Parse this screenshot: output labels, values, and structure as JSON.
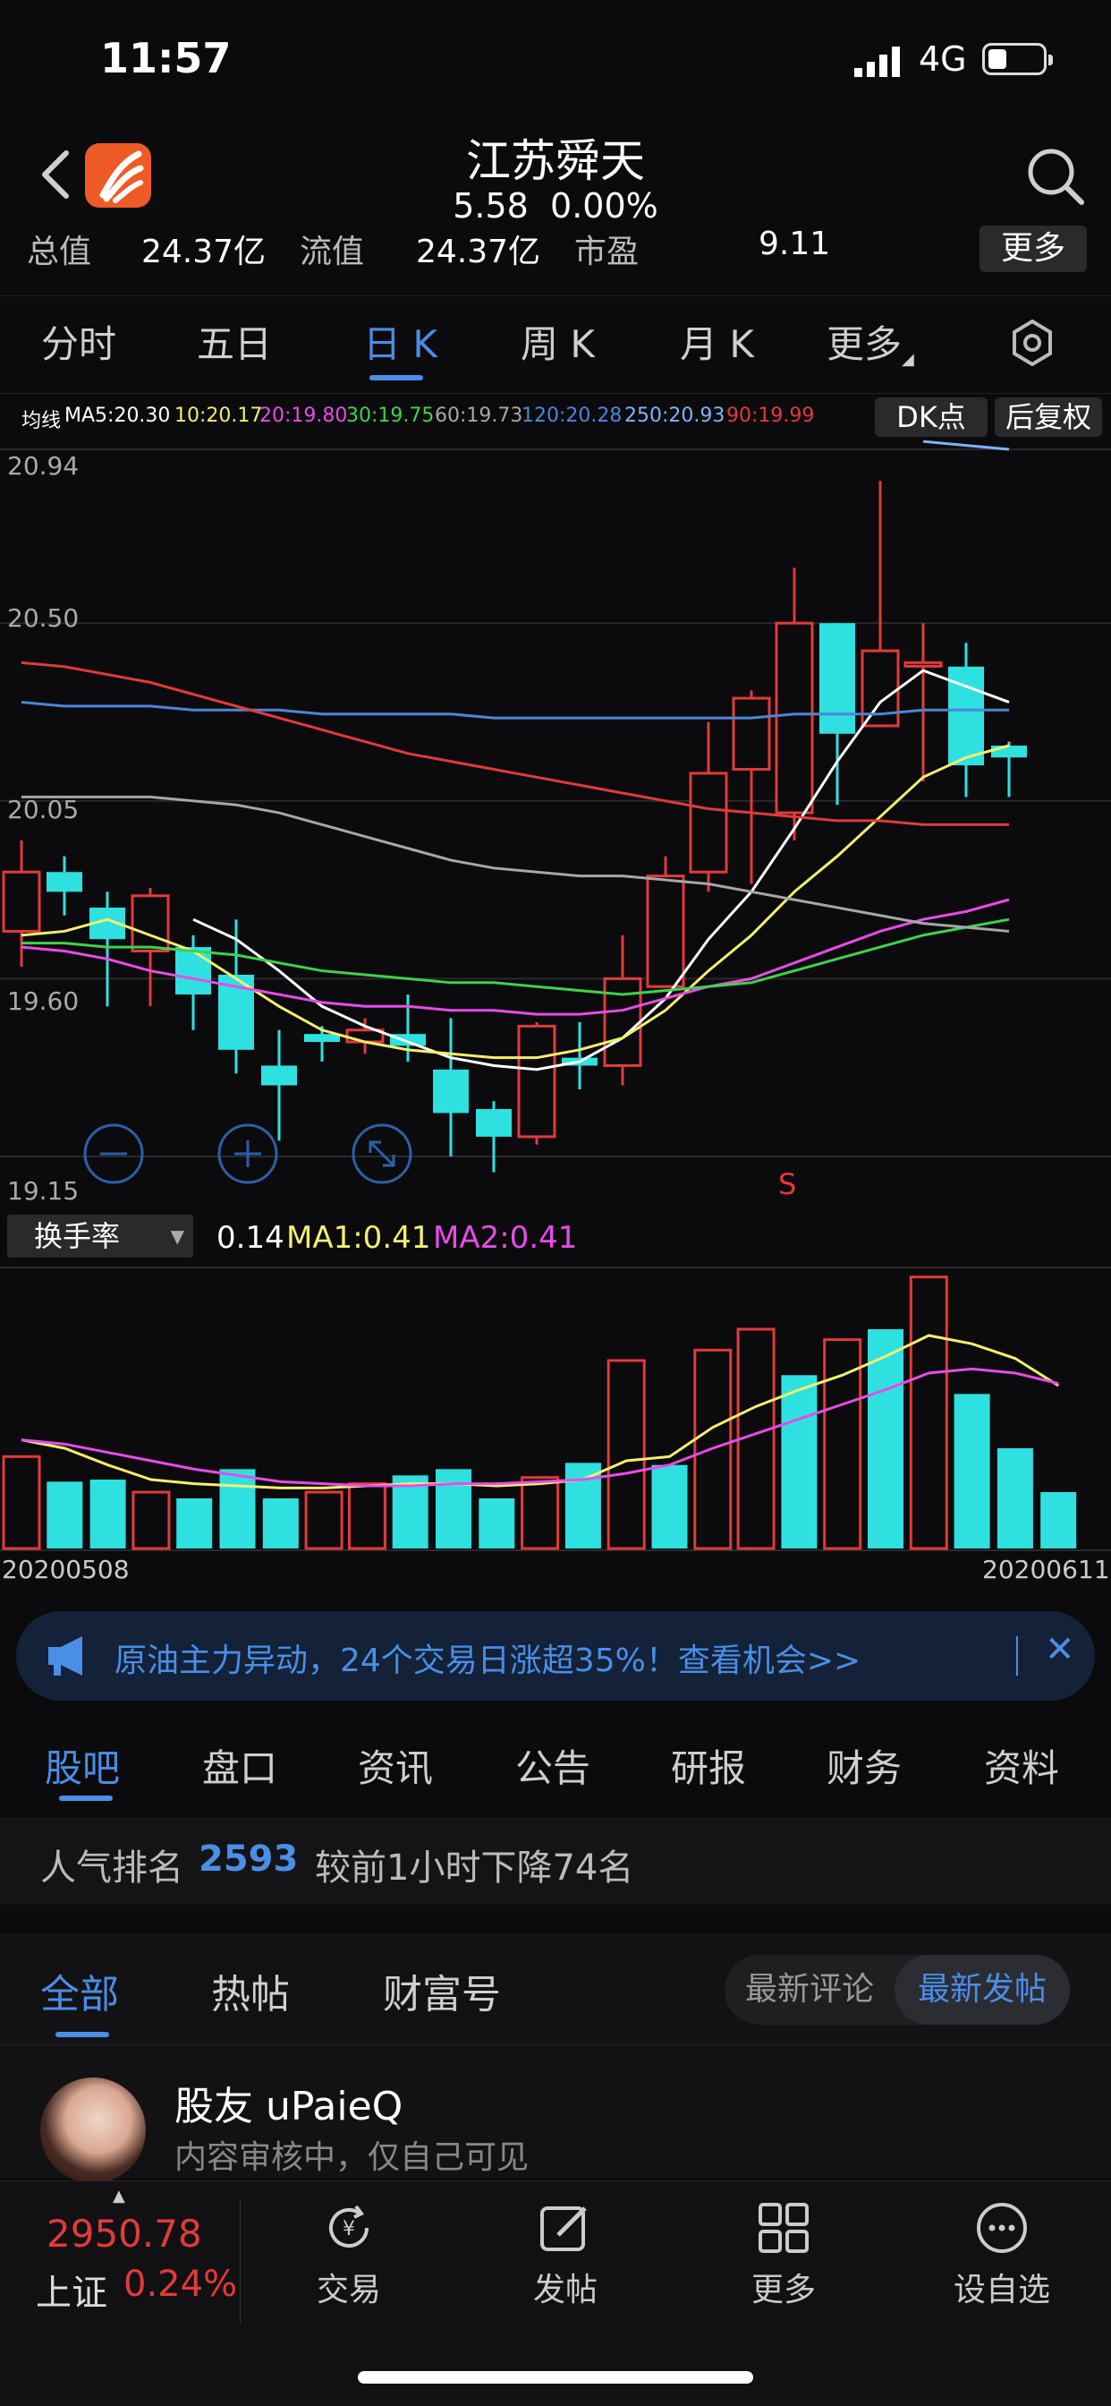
{
  "status_bar": {
    "time": "11:57",
    "network": "4G"
  },
  "header": {
    "title": "江苏舜天",
    "price": "5.58",
    "change_pct": "0.00%"
  },
  "metrics": {
    "total_label": "总值",
    "total_value": "24.37亿",
    "float_label": "流值",
    "float_value": "24.37亿",
    "pe_label": "市盈",
    "pe_value": "9.11",
    "more_label": "更多"
  },
  "period_tabs": [
    "分时",
    "五日",
    "日 K",
    "周 K",
    "月 K",
    "更多"
  ],
  "active_period": "日 K",
  "ma_legend": {
    "prefix": "均线",
    "items": [
      {
        "text": "MA5:20.30",
        "color": "#ffffff"
      },
      {
        "text": "10:20.17",
        "color": "#f4ef6e"
      },
      {
        "text": "20:19.80",
        "color": "#e84be8"
      },
      {
        "text": "30:19.75",
        "color": "#3fd24a"
      },
      {
        "text": "60:19.73",
        "color": "#a7a7a7"
      },
      {
        "text": "120:20.28",
        "color": "#4b86d8"
      },
      {
        "text": "250:20.93",
        "color": "#7fb3ff"
      },
      {
        "text": "90:19.99",
        "color": "#e23a3a"
      }
    ],
    "dk_label": "DK点",
    "adjust_label": "后复权"
  },
  "kline": {
    "y_labels": [
      "20.94",
      "20.50",
      "20.05",
      "19.60",
      "19.15"
    ],
    "signal_label": "S",
    "candles": [
      {
        "o": 19.72,
        "c": 19.87,
        "h": 19.95,
        "l": 19.63
      },
      {
        "o": 19.87,
        "c": 19.82,
        "h": 19.91,
        "l": 19.76
      },
      {
        "o": 19.78,
        "c": 19.7,
        "h": 19.82,
        "l": 19.53
      },
      {
        "o": 19.67,
        "c": 19.81,
        "h": 19.83,
        "l": 19.53
      },
      {
        "o": 19.68,
        "c": 19.56,
        "h": 19.71,
        "l": 19.47
      },
      {
        "o": 19.61,
        "c": 19.42,
        "h": 19.75,
        "l": 19.36
      },
      {
        "o": 19.38,
        "c": 19.33,
        "h": 19.47,
        "l": 19.19
      },
      {
        "o": 19.46,
        "c": 19.44,
        "h": 19.48,
        "l": 19.39
      },
      {
        "o": 19.44,
        "c": 19.47,
        "h": 19.5,
        "l": 19.41
      },
      {
        "o": 19.46,
        "c": 19.43,
        "h": 19.56,
        "l": 19.39
      },
      {
        "o": 19.37,
        "c": 19.26,
        "h": 19.5,
        "l": 19.15
      },
      {
        "o": 19.27,
        "c": 19.2,
        "h": 19.29,
        "l": 19.11
      },
      {
        "o": 19.2,
        "c": 19.48,
        "h": 19.49,
        "l": 19.18
      },
      {
        "o": 19.4,
        "c": 19.38,
        "h": 19.49,
        "l": 19.32
      },
      {
        "o": 19.38,
        "c": 19.6,
        "h": 19.71,
        "l": 19.33
      },
      {
        "o": 19.58,
        "c": 19.86,
        "h": 19.91,
        "l": 19.58
      },
      {
        "o": 19.87,
        "c": 20.12,
        "h": 20.25,
        "l": 19.82
      },
      {
        "o": 20.13,
        "c": 20.31,
        "h": 20.33,
        "l": 19.84
      },
      {
        "o": 20.02,
        "c": 20.5,
        "h": 20.64,
        "l": 19.95
      },
      {
        "o": 20.5,
        "c": 20.22,
        "h": 20.5,
        "l": 20.04
      },
      {
        "o": 20.24,
        "c": 20.43,
        "h": 20.86,
        "l": 20.24
      },
      {
        "o": 20.4,
        "c": 20.4,
        "h": 20.5,
        "l": 20.1
      },
      {
        "o": 20.39,
        "c": 20.14,
        "h": 20.45,
        "l": 20.06
      },
      {
        "o": 20.19,
        "c": 20.16,
        "h": 20.2,
        "l": 20.06
      }
    ],
    "ma_lines": [
      {
        "color": "#ffffff",
        "y": [
          null,
          null,
          null,
          null,
          19.75,
          19.7,
          19.62,
          19.53,
          19.48,
          19.44,
          19.4,
          19.38,
          19.37,
          19.39,
          19.45,
          19.55,
          19.7,
          19.82,
          19.98,
          20.15,
          20.3,
          20.38,
          20.34,
          20.3
        ]
      },
      {
        "color": "#f4ef6e",
        "y": [
          19.71,
          19.72,
          19.75,
          19.71,
          19.67,
          19.6,
          19.53,
          19.47,
          19.44,
          19.42,
          19.41,
          19.4,
          19.4,
          19.42,
          19.45,
          19.52,
          19.62,
          19.71,
          19.82,
          19.91,
          20.01,
          20.11,
          20.16,
          20.19
        ]
      },
      {
        "color": "#e84be8",
        "y": [
          19.68,
          19.67,
          19.65,
          19.62,
          19.6,
          19.58,
          19.56,
          19.54,
          19.53,
          19.53,
          19.52,
          19.52,
          19.51,
          19.51,
          19.52,
          19.55,
          19.58,
          19.6,
          19.64,
          19.68,
          19.72,
          19.75,
          19.77,
          19.8
        ]
      },
      {
        "color": "#3fd24a",
        "y": [
          19.69,
          19.69,
          19.68,
          19.68,
          19.67,
          19.66,
          19.64,
          19.62,
          19.61,
          19.6,
          19.59,
          19.59,
          19.58,
          19.57,
          19.56,
          19.57,
          19.58,
          19.59,
          19.62,
          19.65,
          19.68,
          19.71,
          19.73,
          19.75
        ]
      },
      {
        "color": "#a7a7a7",
        "y": [
          20.06,
          20.06,
          20.06,
          20.06,
          20.05,
          20.04,
          20.02,
          19.99,
          19.96,
          19.93,
          19.9,
          19.88,
          19.87,
          19.86,
          19.86,
          19.85,
          19.84,
          19.82,
          19.8,
          19.78,
          19.76,
          19.74,
          19.73,
          19.72
        ]
      },
      {
        "color": "#4b86d8",
        "y": [
          20.3,
          20.29,
          20.29,
          20.29,
          20.28,
          20.28,
          20.28,
          20.27,
          20.27,
          20.27,
          20.27,
          20.26,
          20.26,
          20.26,
          20.26,
          20.26,
          20.26,
          20.26,
          20.27,
          20.27,
          20.27,
          20.28,
          20.28,
          20.28
        ]
      },
      {
        "color": "#7fb3ff",
        "y": [
          null,
          null,
          null,
          null,
          null,
          null,
          null,
          null,
          null,
          null,
          null,
          null,
          null,
          null,
          null,
          null,
          null,
          null,
          null,
          null,
          null,
          20.96,
          20.95,
          20.94
        ]
      },
      {
        "color": "#e23a3a",
        "y": [
          20.4,
          20.39,
          20.37,
          20.35,
          20.32,
          20.29,
          20.26,
          20.23,
          20.2,
          20.17,
          20.15,
          20.13,
          20.11,
          20.09,
          20.07,
          20.05,
          20.03,
          20.02,
          20.01,
          20.0,
          20.0,
          19.99,
          19.99,
          19.99
        ]
      }
    ]
  },
  "turnover": {
    "selector_label": "换手率",
    "current": "0.14",
    "ma1_text": "MA1:0.41",
    "ma2_text": "MA2:0.41",
    "bars": [
      0.44,
      0.32,
      0.33,
      0.27,
      0.24,
      0.38,
      0.24,
      0.27,
      0.31,
      0.35,
      0.38,
      0.24,
      0.34,
      0.41,
      0.9,
      0.4,
      0.95,
      1.05,
      0.83,
      1.0,
      1.05,
      1.3,
      0.74,
      0.48,
      0.27
    ],
    "up": [
      true,
      false,
      false,
      true,
      false,
      false,
      false,
      true,
      true,
      false,
      false,
      false,
      true,
      false,
      true,
      false,
      true,
      true,
      false,
      true,
      false,
      true,
      false,
      false,
      false
    ],
    "ma1": [
      0.52,
      0.48,
      0.4,
      0.33,
      0.31,
      0.3,
      0.29,
      0.29,
      0.3,
      0.31,
      0.31,
      0.3,
      0.31,
      0.33,
      0.42,
      0.44,
      0.58,
      0.68,
      0.76,
      0.83,
      0.92,
      1.02,
      0.98,
      0.91,
      0.78
    ],
    "ma2": [
      0.52,
      0.5,
      0.46,
      0.42,
      0.38,
      0.35,
      0.32,
      0.31,
      0.3,
      0.3,
      0.31,
      0.31,
      0.32,
      0.33,
      0.36,
      0.4,
      0.48,
      0.55,
      0.62,
      0.69,
      0.76,
      0.84,
      0.86,
      0.84,
      0.79
    ],
    "start_date": "20200508",
    "end_date": "20200611"
  },
  "banner": {
    "text": "原油主力异动，24个交易日涨超35%！查看机会>>"
  },
  "sub_tabs": [
    "股吧",
    "盘口",
    "资讯",
    "公告",
    "研报",
    "财务",
    "资料"
  ],
  "rank": {
    "label": "人气排名",
    "value": "2593",
    "note": "较前1小时下降74名"
  },
  "post_tabs": [
    "全部",
    "热帖",
    "财富号"
  ],
  "sort_options": [
    "最新评论",
    "最新发帖"
  ],
  "post": {
    "user": "股友 uPaieQ",
    "status": "内容审核中，仅自己可见"
  },
  "bottom": {
    "index_value": "2950.78",
    "index_name": "上证",
    "index_pct": "0.24%",
    "nav": [
      "交易",
      "发帖",
      "更多",
      "设自选"
    ]
  },
  "colors": {
    "up": "#e23a3a",
    "down": "#2fe0e0",
    "accent": "#4a8ee6"
  }
}
